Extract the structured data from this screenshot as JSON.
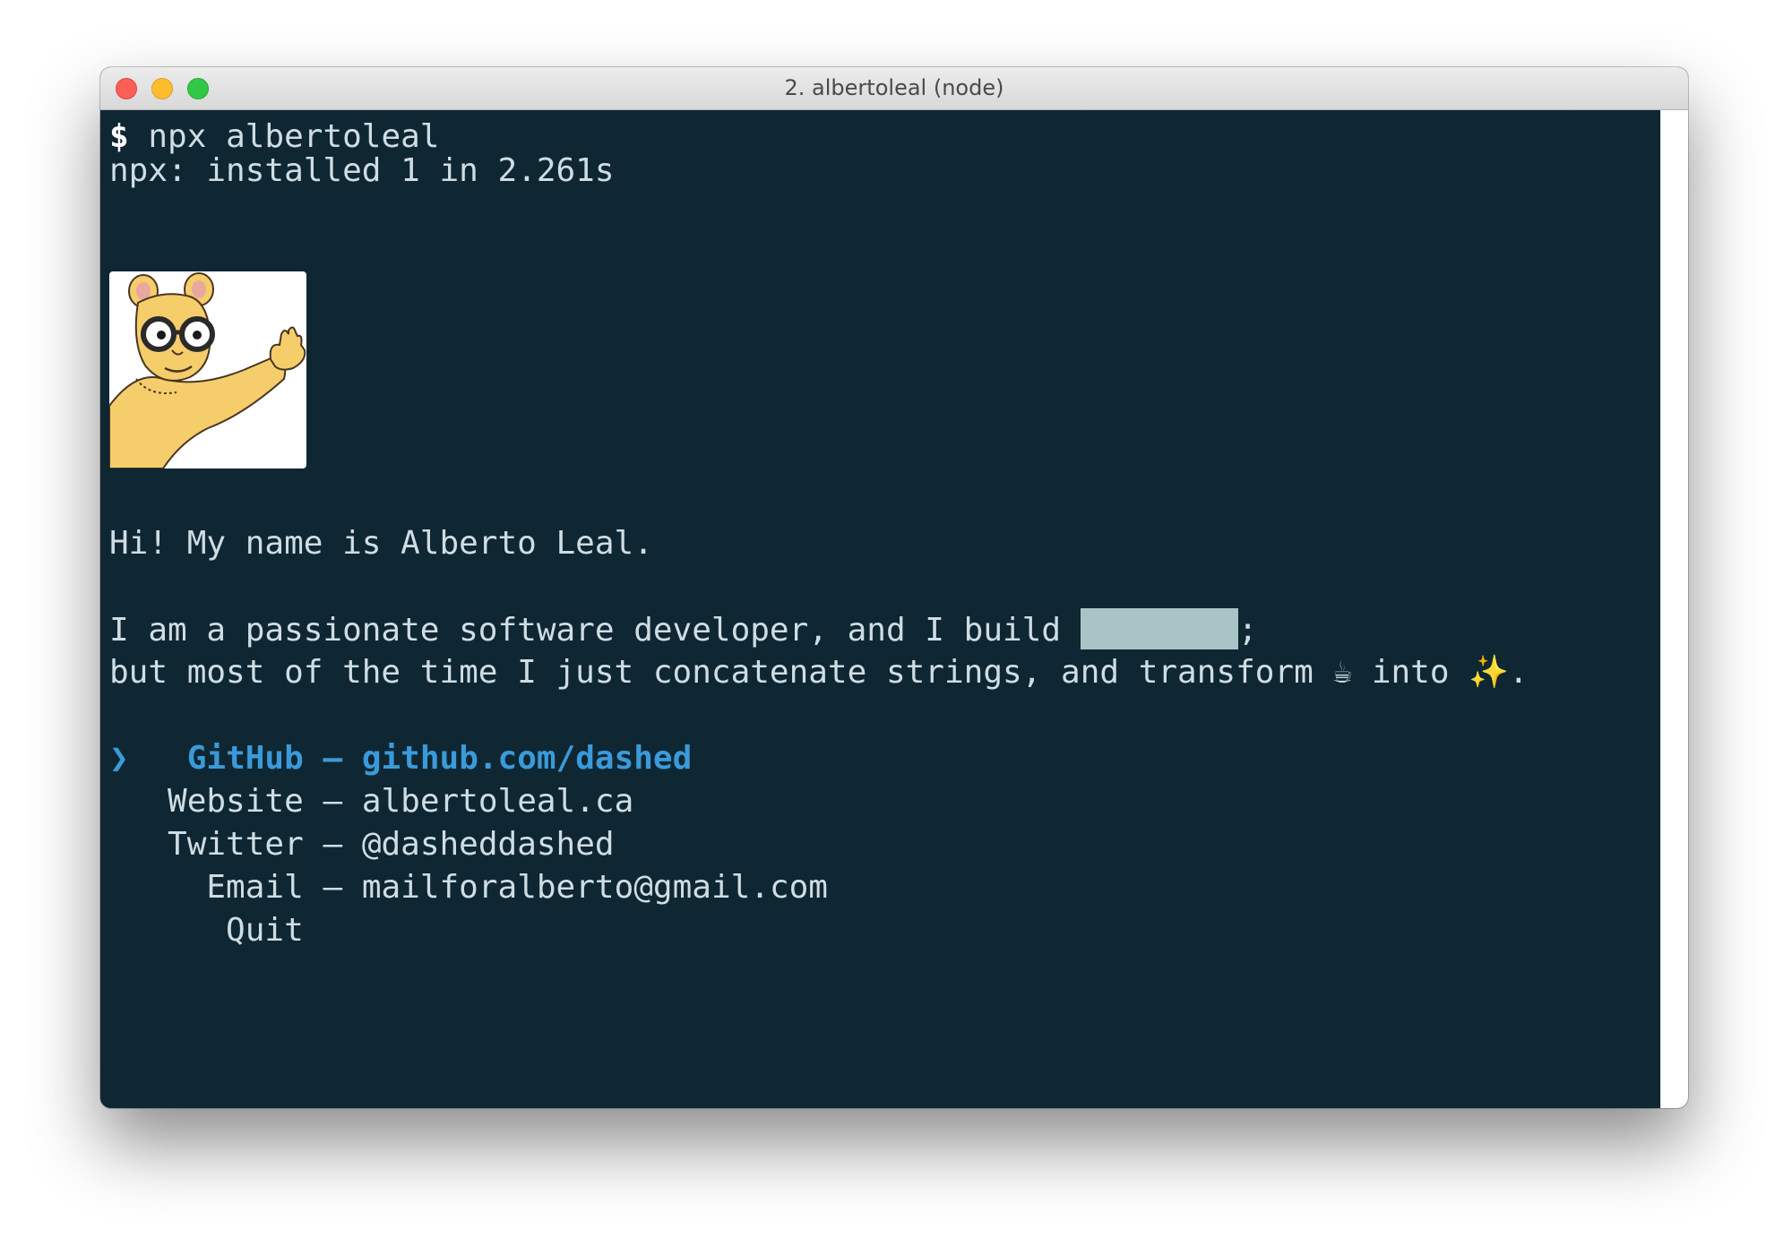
{
  "window": {
    "title": "2. albertoleal (node)"
  },
  "terminal": {
    "prompt_symbol": "$",
    "command": "npx albertoleal",
    "install_output": "npx: installed 1 in 2.261s",
    "greeting": "Hi! My name is Alberto Leal.",
    "about_line1_prefix": "I am a passionate software developer, and I build ",
    "about_line1_suffix": ";",
    "about_line2_prefix": "but most of the time I just concatenate strings, and transform ",
    "about_coffee": "☕",
    "about_into": " into ",
    "about_sparkles": "✨",
    "about_end": "."
  },
  "menu": {
    "pointer": "❯",
    "items": [
      {
        "label": "GitHub",
        "separator": "—",
        "value": "github.com/dashed",
        "selected": true
      },
      {
        "label": "Website",
        "separator": "—",
        "value": "albertoleal.ca",
        "selected": false
      },
      {
        "label": "Twitter",
        "separator": "—",
        "value": "@dasheddashed",
        "selected": false
      },
      {
        "label": "Email",
        "separator": "—",
        "value": "mailforalberto@gmail.com",
        "selected": false
      },
      {
        "label": "Quit",
        "selected": false
      }
    ]
  },
  "colors": {
    "terminal_bg": "#0f2733",
    "text": "#cfdde3",
    "selected": "#3b9ad9",
    "redaction": "#a9c4c6"
  },
  "icons": {
    "avatar": "arthur-cartoon-avatar"
  }
}
